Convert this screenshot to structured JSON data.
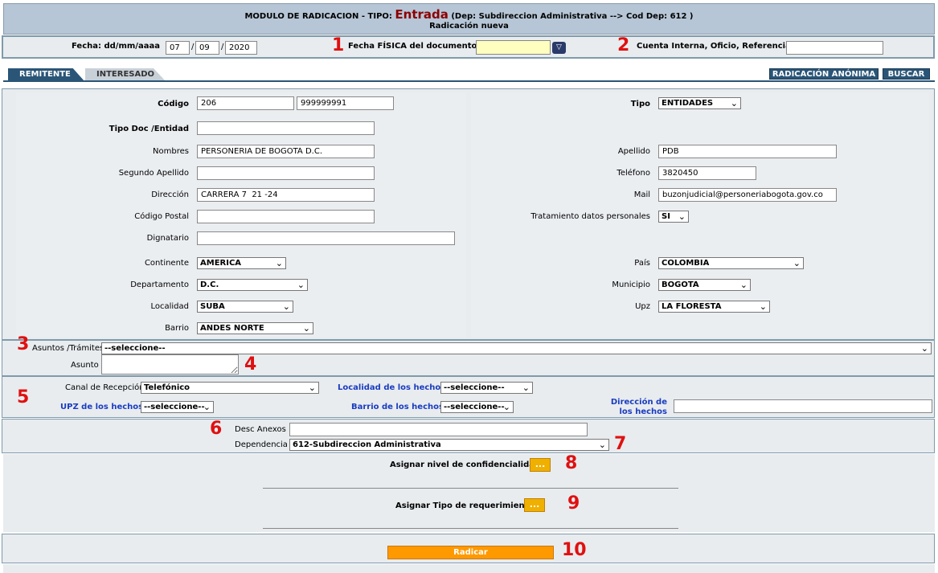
{
  "header": {
    "prefix": "MODULO DE RADICACION - TIPO:",
    "tipo": "Entrada",
    "dep": "(Dep: Subdireccion Administrativa --> Cod Dep: 612 )",
    "subtitle": "Radicación nueva"
  },
  "fecha": {
    "label": "Fecha: dd/mm/aaaa",
    "day": "07",
    "month": "09",
    "year": "2020",
    "sep": "/",
    "fisica_label": "Fecha FÍSICA del documento",
    "fisica_value": "",
    "cuenta_label": "Cuenta Interna, Oficio, Referencia",
    "cuenta_value": ""
  },
  "tabs": {
    "remitente": "REMITENTE",
    "interesado": "INTERESADO"
  },
  "actions": {
    "anonima": "RADICACIÓN ANÓNIMA",
    "buscar": "BUSCAR"
  },
  "remitente": {
    "codigo_label": "Código",
    "codigo1": "206",
    "codigo2": "999999991",
    "tipo_label": "Tipo",
    "tipo_value": "ENTIDADES",
    "tipodoc_label": "Tipo Doc /Entidad",
    "tipodoc_value": "",
    "nombres_label": "Nombres",
    "nombres_value": "PERSONERIA DE BOGOTÁ D.C.",
    "apellido_label": "Apellido",
    "apellido_value": "PDB",
    "segundo_label": "Segundo Apellido",
    "segundo_value": "",
    "telefono_label": "Teléfono",
    "telefono_value": "3820450",
    "direccion_label": "Dirección",
    "direccion_value": "CARRERA 7  21 -24",
    "mail_label": "Mail",
    "mail_value": "buzonjudicial@personeriabogota.gov.co",
    "postal_label": "Código Postal",
    "postal_value": "",
    "tratamiento_label": "Tratamiento datos personales",
    "tratamiento_value": "SI",
    "dignatario_label": "Dignatario",
    "dignatario_value": "",
    "continente_label": "Continente",
    "continente_value": "AMERICA",
    "pais_label": "País",
    "pais_value": "COLOMBIA",
    "departamento_label": "Departamento",
    "departamento_value": "D.C.",
    "municipio_label": "Municipio",
    "municipio_value": "BOGOTA",
    "localidad_label": "Localidad",
    "localidad_value": "SUBA",
    "upz_label": "Upz",
    "upz_value": "LA FLORESTA",
    "barrio_label": "Barrio",
    "barrio_value": "ANDES NORTE"
  },
  "asuntos": {
    "label": "Asuntos /Trámites",
    "value": "--seleccione--",
    "asunto_label": "Asunto",
    "asunto_value": ""
  },
  "hechos": {
    "canal_label": "Canal de Recepción",
    "canal_value": "Telefónico",
    "localidad_label": "Localidad de los hechos",
    "localidad_value": "--seleccione--",
    "upz_label": "UPZ de los hechos",
    "upz_value": "--seleccione--",
    "barrio_label": "Barrio de los hechos",
    "barrio_value": "--seleccione--",
    "direccion_label_1": "Dirección de",
    "direccion_label_2": "los hechos",
    "direccion_value": ""
  },
  "anexos": {
    "desc_label": "Desc Anexos",
    "desc_value": "",
    "dependencia_label": "Dependencia",
    "dependencia_value": "612-Subdireccion Administrativa"
  },
  "confidencialidad": {
    "label": "Asignar nivel de confidencialidad:",
    "button": "..."
  },
  "requerimiento": {
    "label": "Asignar Tipo de requerimiento:",
    "button": "..."
  },
  "radicar": "Radicar",
  "markers": [
    "1",
    "2",
    "3",
    "4",
    "5",
    "6",
    "7",
    "8",
    "9",
    "10"
  ],
  "colors": {
    "header_bg": "#b6c6d6",
    "tipo": "#8b0000",
    "radicar": "#ff9900",
    "marker": "#e01010"
  }
}
